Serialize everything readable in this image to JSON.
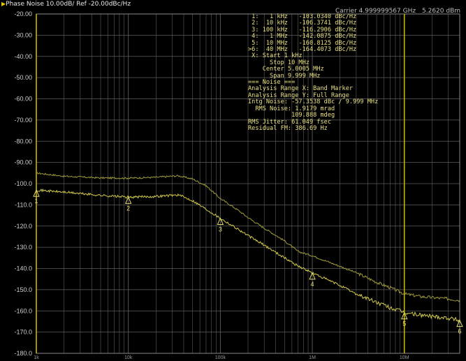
{
  "header": {
    "title": "Phase Noise 10.00dB/ Ref -20.00dBc/Hz",
    "carrier": "Carrier 4.999999567 GHz",
    "power": "5.2620 dBm"
  },
  "colors": {
    "background": "#000000",
    "grid": "#5e5e5e",
    "trace_smoothed": "#a09a3a",
    "trace_raw": "#d4cc4a",
    "marker_line": "#c8b400",
    "text": "#e8e080"
  },
  "readout": {
    "markers": [
      {
        "label": " 1:",
        "freq": "  1 kHz",
        "value": "-103.0340 dBc/Hz"
      },
      {
        "label": " 2:",
        "freq": " 10 kHz",
        "value": "-106.3741 dBc/Hz"
      },
      {
        "label": " 3:",
        "freq": "100 kHz",
        "value": "-116.2906 dBc/Hz"
      },
      {
        "label": " 4:",
        "freq": "  1 MHz",
        "value": "-142.0875 dBc/Hz"
      },
      {
        "label": " 5:",
        "freq": " 10 MHz",
        "value": "-160.8125 dBc/Hz"
      },
      {
        "label": ">6:",
        "freq": " 40 MHz",
        "value": "-164.4073 dBc/Hz"
      }
    ],
    "lines": [
      " X: Start 1 kHz",
      "      Stop 10 MHz",
      "    Center 5.0005 MHz",
      "      Span 9.999 MHz",
      "=== Noise ===",
      "Analysis Range X: Band Marker",
      "Analysis Range Y: Full Range",
      "Intg Noise: -57.3538 dBc / 9.999 MHz",
      "  RMS Noise: 1.9179 mrad",
      "            109.888 mdeg",
      "RMS Jitter: 61.049 fsec",
      "Residual FM: 386.69 Hz"
    ]
  },
  "chart_data": {
    "type": "line",
    "title": "Phase Noise 10.00dB/ Ref -20.00dBc/Hz",
    "xscale": "log",
    "xlim": [
      1000,
      40000000
    ],
    "ylim": [
      -180,
      -20
    ],
    "y_ticks": [
      -20,
      -30,
      -40,
      -50,
      -60,
      -70,
      -80,
      -90,
      -100,
      -110,
      -120,
      -130,
      -140,
      -150,
      -160,
      -170,
      -180
    ],
    "y_tick_labels": [
      "-20.00",
      "-30.00",
      "-40.00",
      "-50.00",
      "-60.00",
      "-70.00",
      "-80.00",
      "-90.00",
      "-100.0",
      "-110.0",
      "-120.0",
      "-130.0",
      "-140.0",
      "-150.0",
      "-160.0",
      "-170.0",
      "-180.0"
    ],
    "x_ticks": [
      1000,
      10000,
      100000,
      1000000,
      10000000
    ],
    "x_tick_labels": [
      "1k",
      "10k",
      "100k",
      "1M",
      "10M"
    ],
    "grid": true,
    "series": [
      {
        "x": [
          1000,
          2000,
          5000,
          10000,
          20000,
          35000,
          50000,
          70000,
          100000,
          150000,
          200000,
          300000,
          500000,
          700000,
          1000000,
          2000000,
          3000000,
          5000000,
          7000000,
          10000000,
          15000000,
          20000000,
          30000000,
          40000000
        ],
        "y": [
          -95,
          -96.5,
          -97.3,
          -97.4,
          -97,
          -96.3,
          -97.8,
          -101,
          -107,
          -112,
          -116,
          -121,
          -127,
          -132,
          -134,
          -139,
          -142,
          -146.5,
          -149,
          -152,
          -153.2,
          -153.7,
          -154.3,
          -155
        ]
      },
      {
        "x": [
          1000,
          2000,
          5000,
          10000,
          20000,
          35000,
          50000,
          70000,
          100000,
          150000,
          200000,
          300000,
          500000,
          700000,
          1000000,
          2000000,
          3000000,
          5000000,
          7000000,
          10000000,
          15000000,
          20000000,
          30000000,
          40000000
        ],
        "y": [
          -103,
          -104,
          -105.5,
          -106.4,
          -106,
          -105.3,
          -108,
          -112,
          -116.3,
          -121,
          -124.5,
          -129,
          -135,
          -138.8,
          -142.1,
          -148,
          -152,
          -156,
          -158.5,
          -160.8,
          -162,
          -162.5,
          -163.3,
          -164.4
        ]
      }
    ],
    "markers": [
      {
        "label": "1",
        "x": 1000,
        "y": -103.034
      },
      {
        "label": "2",
        "x": 10000,
        "y": -106.3741
      },
      {
        "label": "3",
        "x": 100000,
        "y": -116.2906
      },
      {
        "label": "4",
        "x": 1000000,
        "y": -142.0875
      },
      {
        "label": "5",
        "x": 10000000,
        "y": -160.8125
      },
      {
        "label": "6",
        "x": 40000000,
        "y": -164.4073
      }
    ],
    "band_markers": [
      1000,
      10000000
    ]
  }
}
